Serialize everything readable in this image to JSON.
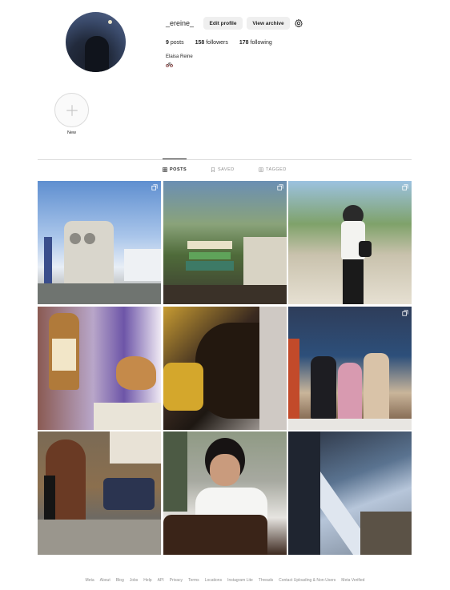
{
  "profile": {
    "username": "_ereine_",
    "edit_label": "Edit profile",
    "archive_label": "View archive",
    "full_name": "Elaisa Reine",
    "stats": {
      "posts_count": "9",
      "posts_label": "posts",
      "followers_count": "158",
      "followers_label": "followers",
      "following_count": "178",
      "following_label": "following"
    }
  },
  "highlight": {
    "label": "New"
  },
  "tabs": {
    "posts": "POSTS",
    "saved": "SAVED",
    "tagged": "TAGGED"
  },
  "posts": [
    {
      "multi": true
    },
    {
      "multi": true
    },
    {
      "multi": true
    },
    {
      "multi": false
    },
    {
      "multi": false
    },
    {
      "multi": true
    },
    {
      "multi": false
    },
    {
      "multi": false
    },
    {
      "multi": false
    }
  ],
  "footer": {
    "links": [
      "Meta",
      "About",
      "Blog",
      "Jobs",
      "Help",
      "API",
      "Privacy",
      "Terms",
      "Locations",
      "Instagram Lite",
      "Threads",
      "Contact Uploading & Non-Users",
      "Meta Verified"
    ]
  },
  "icons": {
    "gear": "gear-icon",
    "plus": "plus-icon",
    "grid": "grid-icon",
    "bookmark": "bookmark-icon",
    "tag": "tag-icon",
    "multi": "multiple-photos-icon"
  }
}
